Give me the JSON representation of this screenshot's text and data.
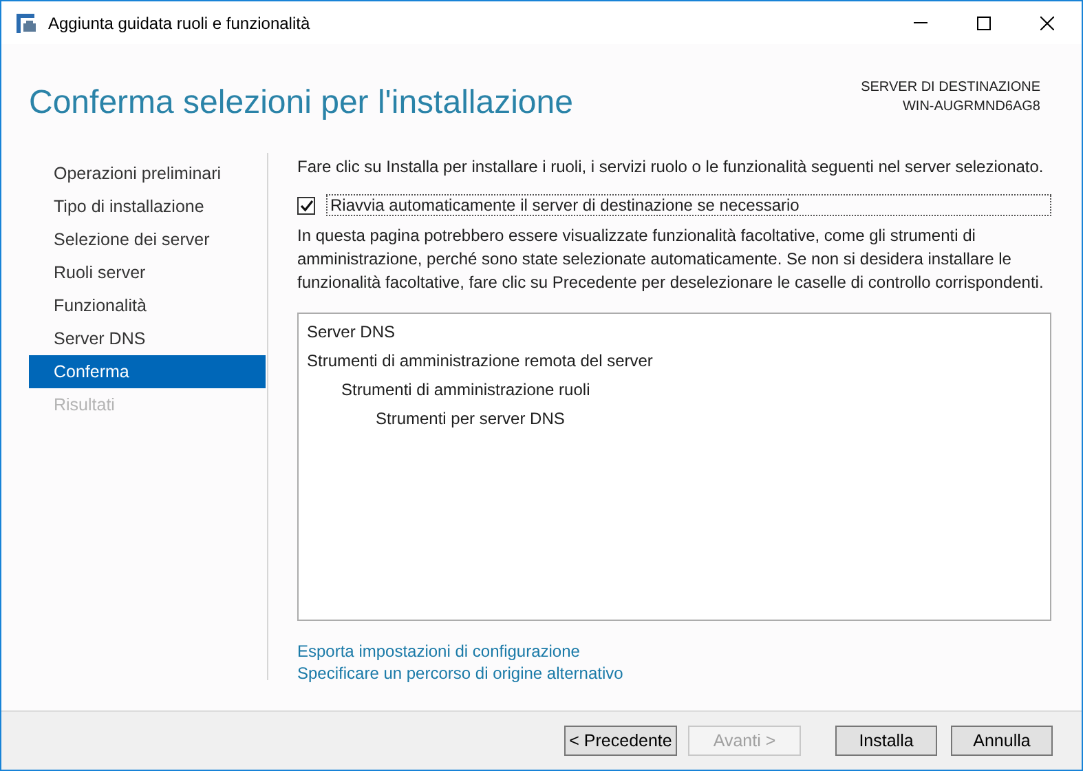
{
  "window": {
    "title": "Aggiunta guidata ruoli e funzionalità"
  },
  "header": {
    "title": "Conferma selezioni per l'installazione",
    "destination_label": "SERVER DI DESTINAZIONE",
    "destination_server": "WIN-AUGRMND6AG8"
  },
  "sidebar": {
    "items": [
      {
        "label": "Operazioni preliminari",
        "selected": false,
        "disabled": false
      },
      {
        "label": "Tipo di installazione",
        "selected": false,
        "disabled": false
      },
      {
        "label": "Selezione dei server",
        "selected": false,
        "disabled": false
      },
      {
        "label": "Ruoli server",
        "selected": false,
        "disabled": false
      },
      {
        "label": "Funzionalità",
        "selected": false,
        "disabled": false
      },
      {
        "label": "Server DNS",
        "selected": false,
        "disabled": false
      },
      {
        "label": "Conferma",
        "selected": true,
        "disabled": false
      },
      {
        "label": "Risultati",
        "selected": false,
        "disabled": true
      }
    ]
  },
  "intro": "Fare clic su Installa per installare i ruoli, i servizi ruolo o le funzionalità seguenti nel server selezionato.",
  "restart_checkbox": {
    "label": "Riavvia automaticamente il server di destinazione se necessario",
    "checked": true
  },
  "note": "In questa pagina potrebbero essere visualizzate funzionalità facoltative, come gli strumenti di amministrazione, perché sono state selezionate automaticamente. Se non si desidera installare le funzionalità facoltative, fare clic su Precedente per deselezionare le caselle di controllo corrispondenti.",
  "selections": [
    {
      "label": "Server DNS"
    },
    {
      "label": "Strumenti di amministrazione remota del server",
      "children": [
        {
          "label": "Strumenti di amministrazione ruoli",
          "children": [
            {
              "label": "Strumenti per server DNS"
            }
          ]
        }
      ]
    }
  ],
  "links": [
    "Esporta impostazioni di configurazione",
    "Specificare un percorso di origine alternativo"
  ],
  "buttons": [
    {
      "label": "< Precedente",
      "disabled": false
    },
    {
      "label": "Avanti >",
      "disabled": true
    },
    {
      "label": "Installa",
      "disabled": false
    },
    {
      "label": "Annulla",
      "disabled": false
    }
  ]
}
